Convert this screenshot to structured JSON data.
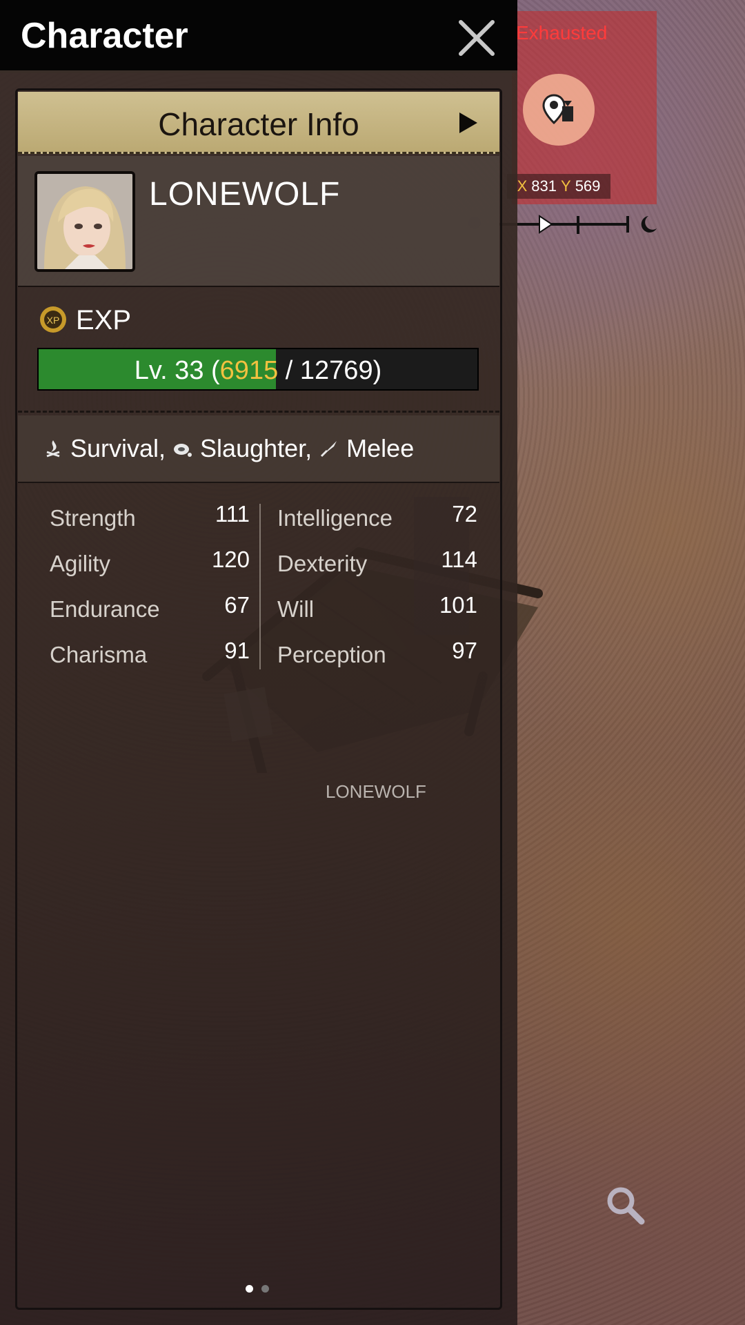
{
  "header": {
    "title": "Character"
  },
  "hud": {
    "status": "Exhausted",
    "coords": {
      "x_label": "X",
      "x_value": "831",
      "y_label": "Y",
      "y_value": "569"
    }
  },
  "tab": {
    "label": "Character Info"
  },
  "player": {
    "name": "LONEWOLF"
  },
  "exp": {
    "label": "EXP",
    "level_text": "Lv. 33",
    "open_paren": "(",
    "current": "6915",
    "separator": "/",
    "max": "12769",
    "close_paren": ")",
    "progress_fraction": 0.5415
  },
  "skills": [
    {
      "label": "Survival,",
      "icon": "campfire-icon"
    },
    {
      "label": "Slaughter,",
      "icon": "meat-icon"
    },
    {
      "label": "Melee",
      "icon": "blade-icon"
    }
  ],
  "stats_left": [
    {
      "name": "Strength",
      "value": "111"
    },
    {
      "name": "Agility",
      "value": "120"
    },
    {
      "name": "Endurance",
      "value": "67"
    },
    {
      "name": "Charisma",
      "value": "91"
    }
  ],
  "stats_right": [
    {
      "name": "Intelligence",
      "value": "72"
    },
    {
      "name": "Dexterity",
      "value": "114"
    },
    {
      "name": "Will",
      "value": "101"
    },
    {
      "name": "Perception",
      "value": "97"
    }
  ],
  "world": {
    "nameplate": "LONEWOLF"
  },
  "pagination": {
    "pages": 2,
    "active": 1
  },
  "colors": {
    "exp_fill": "#2c8a2e",
    "exp_current": "#f2c140",
    "status_red": "#ff3b3b",
    "tab_bg": "#c9b98a"
  }
}
